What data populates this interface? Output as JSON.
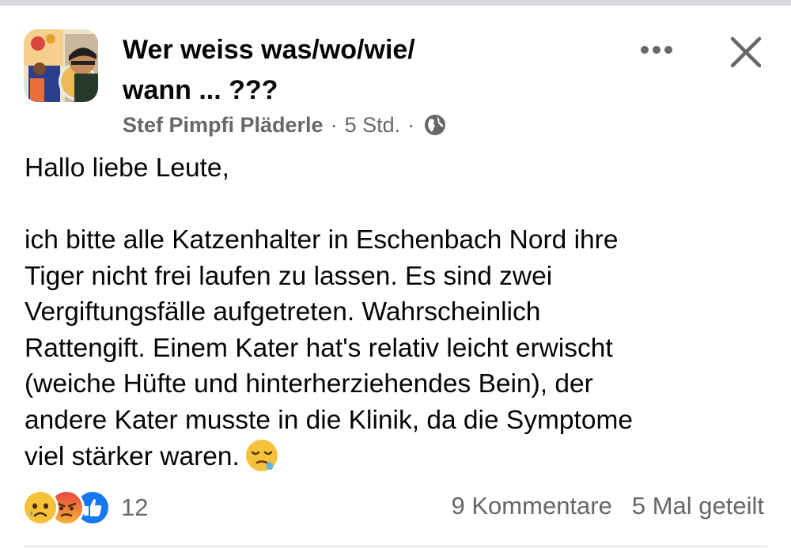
{
  "group": {
    "title": "Wer weiss was/wo/wie/\nwann ... ???"
  },
  "post": {
    "author": "Stef Pimpfi Pläderle",
    "separator": "·",
    "time": "5 Std.",
    "audience_icon": "globe-icon",
    "greeting": "Hallo liebe Leute,",
    "body": "ich bitte alle Katzenhalter in Eschenbach Nord ihre\nTiger nicht frei laufen zu lassen. Es sind zwei\nVergiftungsfälle aufgetreten. Wahrscheinlich\nRattengift. Einem Kater hat's relativ leicht erwischt\n(weiche Hüfte und hinterherziehendes Bein), der\nandere Kater musste in die Klinik, da die Symptome\nviel stärker waren.",
    "body_emoji": "sleepy-face-icon"
  },
  "header_actions": {
    "more_icon": "more-dots-icon",
    "close_icon": "close-icon"
  },
  "reactions": {
    "icons": [
      "sad-reaction-icon",
      "angry-reaction-icon",
      "like-reaction-icon"
    ],
    "count": "12"
  },
  "stats": {
    "comments": "9 Kommentare",
    "shares": "5 Mal geteilt"
  },
  "colors": {
    "secondary_text": "#65676b",
    "like_blue": "#1877f2",
    "divider": "#e4e6eb"
  }
}
